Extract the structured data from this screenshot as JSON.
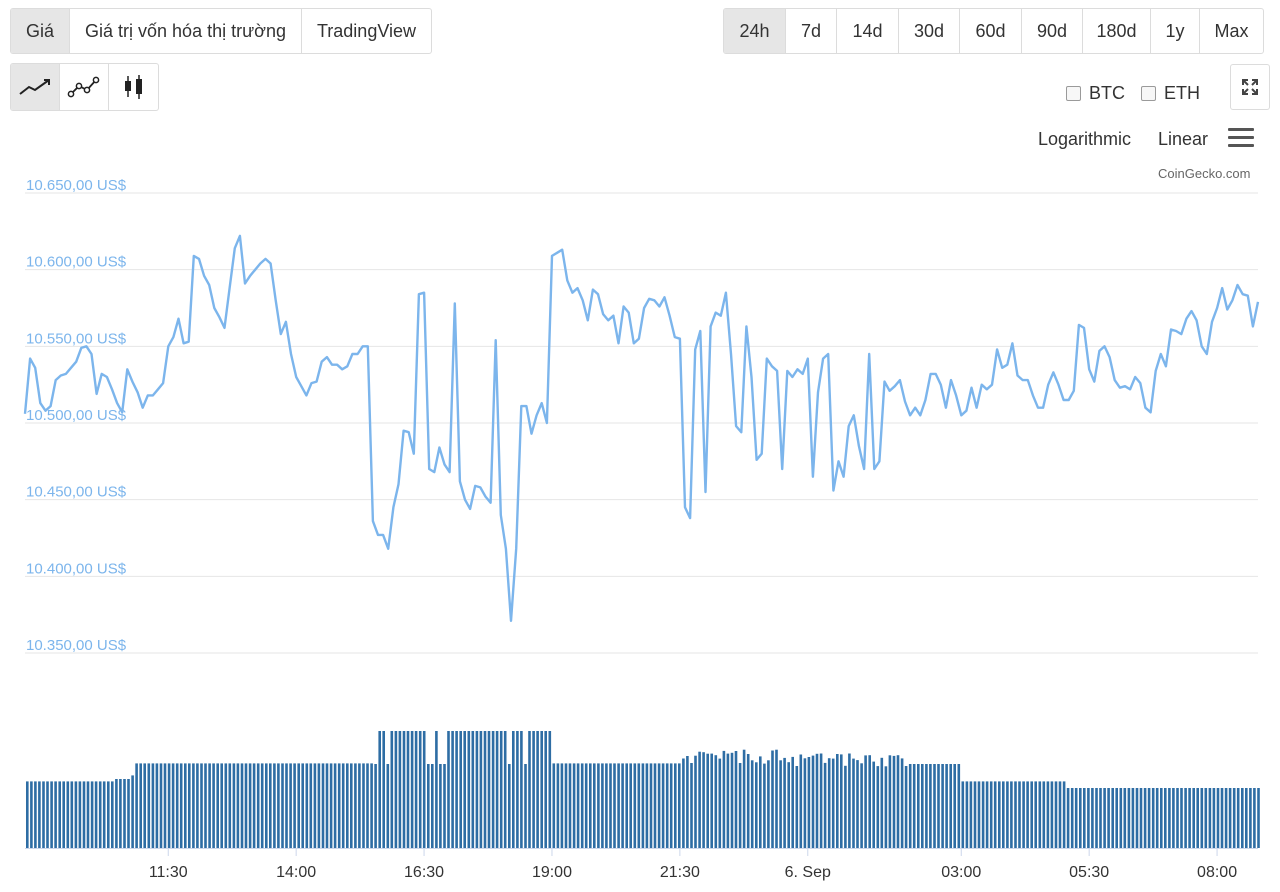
{
  "tabs": [
    {
      "label": "Giá",
      "active": true
    },
    {
      "label": "Giá trị vốn hóa thị trường",
      "active": false
    },
    {
      "label": "TradingView",
      "active": false
    }
  ],
  "ranges": [
    {
      "label": "24h",
      "active": true
    },
    {
      "label": "7d",
      "active": false
    },
    {
      "label": "14d",
      "active": false
    },
    {
      "label": "30d",
      "active": false
    },
    {
      "label": "60d",
      "active": false
    },
    {
      "label": "90d",
      "active": false
    },
    {
      "label": "180d",
      "active": false
    },
    {
      "label": "1y",
      "active": false
    },
    {
      "label": "Max",
      "active": false
    }
  ],
  "chart_styles": [
    {
      "icon": "line-chart-icon",
      "active": true
    },
    {
      "icon": "point-line-chart-icon",
      "active": false
    },
    {
      "icon": "candlestick-chart-icon",
      "active": false
    }
  ],
  "compare": {
    "btc": "BTC",
    "eth": "ETH"
  },
  "scale": {
    "logarithmic": "Logarithmic",
    "linear": "Linear"
  },
  "credit": "CoinGecko.com",
  "colors": {
    "line": "#7cb5ec",
    "volume": "#2e6da4",
    "axis_text": "#7cb5ec",
    "grid": "#e6e6e6"
  },
  "chart_data": {
    "type": "line",
    "y_axis": {
      "ticks": [
        10650,
        10600,
        10550,
        10500,
        10450,
        10400,
        10350
      ],
      "tick_labels": [
        "10.650,00 US$",
        "10.600,00 US$",
        "10.550,00 US$",
        "10.500,00 US$",
        "10.450,00 US$",
        "10.400,00 US$",
        "10.350,00 US$"
      ],
      "range": [
        10350,
        10650
      ]
    },
    "x_axis": {
      "ticks": [
        "11:30",
        "14:00",
        "16:30",
        "19:00",
        "21:30",
        "6. Sep",
        "03:00",
        "05:30",
        "08:00"
      ],
      "range_hours": [
        8.7,
        32.8
      ],
      "tick_hours": [
        11.5,
        14,
        16.5,
        19,
        21.5,
        24,
        27,
        29.5,
        32
      ]
    },
    "price_series": [
      [
        8.7,
        10506
      ],
      [
        8.8,
        10542
      ],
      [
        8.9,
        10536
      ],
      [
        9.0,
        10513
      ],
      [
        9.1,
        10508
      ],
      [
        9.2,
        10511
      ],
      [
        9.3,
        10528
      ],
      [
        9.4,
        10531
      ],
      [
        9.5,
        10532
      ],
      [
        9.6,
        10536
      ],
      [
        9.7,
        10540
      ],
      [
        9.8,
        10549
      ],
      [
        9.9,
        10550
      ],
      [
        10.0,
        10545
      ],
      [
        10.1,
        10519
      ],
      [
        10.2,
        10532
      ],
      [
        10.3,
        10530
      ],
      [
        10.4,
        10522
      ],
      [
        10.5,
        10513
      ],
      [
        10.6,
        10507
      ],
      [
        10.7,
        10535
      ],
      [
        10.8,
        10527
      ],
      [
        10.9,
        10520
      ],
      [
        11.0,
        10510
      ],
      [
        11.1,
        10518
      ],
      [
        11.2,
        10518
      ],
      [
        11.3,
        10522
      ],
      [
        11.4,
        10526
      ],
      [
        11.5,
        10550
      ],
      [
        11.6,
        10556
      ],
      [
        11.7,
        10568
      ],
      [
        11.8,
        10552
      ],
      [
        11.9,
        10553
      ],
      [
        12.0,
        10609
      ],
      [
        12.1,
        10607
      ],
      [
        12.2,
        10596
      ],
      [
        12.3,
        10590
      ],
      [
        12.4,
        10575
      ],
      [
        12.5,
        10569
      ],
      [
        12.6,
        10562
      ],
      [
        12.7,
        10588
      ],
      [
        12.8,
        10614
      ],
      [
        12.9,
        10622
      ],
      [
        13.0,
        10591
      ],
      [
        13.1,
        10596
      ],
      [
        13.2,
        10600
      ],
      [
        13.3,
        10604
      ],
      [
        13.4,
        10607
      ],
      [
        13.5,
        10604
      ],
      [
        13.6,
        10580
      ],
      [
        13.7,
        10558
      ],
      [
        13.8,
        10566
      ],
      [
        13.9,
        10545
      ],
      [
        14.0,
        10530
      ],
      [
        14.1,
        10524
      ],
      [
        14.2,
        10518
      ],
      [
        14.3,
        10526
      ],
      [
        14.4,
        10527
      ],
      [
        14.5,
        10540
      ],
      [
        14.6,
        10543
      ],
      [
        14.7,
        10538
      ],
      [
        14.8,
        10538
      ],
      [
        14.9,
        10535
      ],
      [
        15.0,
        10537
      ],
      [
        15.1,
        10545
      ],
      [
        15.2,
        10545
      ],
      [
        15.3,
        10550
      ],
      [
        15.4,
        10550
      ],
      [
        15.5,
        10436
      ],
      [
        15.6,
        10427
      ],
      [
        15.7,
        10427
      ],
      [
        15.8,
        10418
      ],
      [
        15.9,
        10445
      ],
      [
        16.0,
        10460
      ],
      [
        16.1,
        10495
      ],
      [
        16.2,
        10494
      ],
      [
        16.3,
        10480
      ],
      [
        16.4,
        10584
      ],
      [
        16.5,
        10585
      ],
      [
        16.6,
        10470
      ],
      [
        16.7,
        10468
      ],
      [
        16.8,
        10484
      ],
      [
        16.9,
        10473
      ],
      [
        17.0,
        10468
      ],
      [
        17.1,
        10578
      ],
      [
        17.2,
        10462
      ],
      [
        17.3,
        10450
      ],
      [
        17.4,
        10444
      ],
      [
        17.5,
        10459
      ],
      [
        17.6,
        10458
      ],
      [
        17.7,
        10452
      ],
      [
        17.8,
        10448
      ],
      [
        17.9,
        10554
      ],
      [
        18.0,
        10440
      ],
      [
        18.1,
        10418
      ],
      [
        18.2,
        10371
      ],
      [
        18.3,
        10418
      ],
      [
        18.4,
        10511
      ],
      [
        18.5,
        10511
      ],
      [
        18.6,
        10493
      ],
      [
        18.7,
        10505
      ],
      [
        18.8,
        10513
      ],
      [
        18.9,
        10500
      ],
      [
        19.0,
        10609
      ],
      [
        19.1,
        10611
      ],
      [
        19.2,
        10613
      ],
      [
        19.3,
        10593
      ],
      [
        19.4,
        10585
      ],
      [
        19.5,
        10588
      ],
      [
        19.6,
        10580
      ],
      [
        19.7,
        10567
      ],
      [
        19.8,
        10587
      ],
      [
        19.9,
        10584
      ],
      [
        20.0,
        10571
      ],
      [
        20.1,
        10567
      ],
      [
        20.2,
        10570
      ],
      [
        20.3,
        10552
      ],
      [
        20.4,
        10576
      ],
      [
        20.5,
        10572
      ],
      [
        20.6,
        10552
      ],
      [
        20.7,
        10555
      ],
      [
        20.8,
        10575
      ],
      [
        20.9,
        10581
      ],
      [
        21.0,
        10580
      ],
      [
        21.1,
        10576
      ],
      [
        21.2,
        10582
      ],
      [
        21.3,
        10570
      ],
      [
        21.4,
        10556
      ],
      [
        21.5,
        10555
      ],
      [
        21.6,
        10445
      ],
      [
        21.7,
        10438
      ],
      [
        21.8,
        10548
      ],
      [
        21.9,
        10560
      ],
      [
        22.0,
        10455
      ],
      [
        22.1,
        10563
      ],
      [
        22.2,
        10572
      ],
      [
        22.3,
        10570
      ],
      [
        22.4,
        10585
      ],
      [
        22.5,
        10545
      ],
      [
        22.6,
        10498
      ],
      [
        22.7,
        10494
      ],
      [
        22.8,
        10563
      ],
      [
        22.9,
        10530
      ],
      [
        23.0,
        10476
      ],
      [
        23.1,
        10480
      ],
      [
        23.2,
        10542
      ],
      [
        23.3,
        10537
      ],
      [
        23.4,
        10534
      ],
      [
        23.5,
        10470
      ],
      [
        23.6,
        10534
      ],
      [
        23.7,
        10530
      ],
      [
        23.8,
        10535
      ],
      [
        23.9,
        10532
      ],
      [
        24.0,
        10542
      ],
      [
        24.1,
        10465
      ],
      [
        24.2,
        10520
      ],
      [
        24.3,
        10542
      ],
      [
        24.4,
        10545
      ],
      [
        24.5,
        10456
      ],
      [
        24.6,
        10475
      ],
      [
        24.7,
        10465
      ],
      [
        24.8,
        10498
      ],
      [
        24.9,
        10505
      ],
      [
        25.0,
        10485
      ],
      [
        25.1,
        10470
      ],
      [
        25.2,
        10545
      ],
      [
        25.3,
        10470
      ],
      [
        25.4,
        10475
      ],
      [
        25.5,
        10527
      ],
      [
        25.6,
        10521
      ],
      [
        25.7,
        10524
      ],
      [
        25.8,
        10528
      ],
      [
        25.9,
        10514
      ],
      [
        26.0,
        10505
      ],
      [
        26.1,
        10510
      ],
      [
        26.2,
        10505
      ],
      [
        26.3,
        10515
      ],
      [
        26.4,
        10532
      ],
      [
        26.5,
        10532
      ],
      [
        26.6,
        10525
      ],
      [
        26.7,
        10510
      ],
      [
        26.8,
        10528
      ],
      [
        26.9,
        10518
      ],
      [
        27.0,
        10505
      ],
      [
        27.1,
        10508
      ],
      [
        27.2,
        10523
      ],
      [
        27.3,
        10510
      ],
      [
        27.4,
        10525
      ],
      [
        27.5,
        10522
      ],
      [
        27.6,
        10525
      ],
      [
        27.7,
        10548
      ],
      [
        27.8,
        10536
      ],
      [
        27.9,
        10538
      ],
      [
        28.0,
        10552
      ],
      [
        28.1,
        10531
      ],
      [
        28.2,
        10528
      ],
      [
        28.3,
        10528
      ],
      [
        28.4,
        10518
      ],
      [
        28.5,
        10510
      ],
      [
        28.6,
        10510
      ],
      [
        28.7,
        10525
      ],
      [
        28.8,
        10533
      ],
      [
        28.9,
        10525
      ],
      [
        29.0,
        10515
      ],
      [
        29.1,
        10515
      ],
      [
        29.2,
        10521
      ],
      [
        29.3,
        10564
      ],
      [
        29.4,
        10562
      ],
      [
        29.5,
        10535
      ],
      [
        29.6,
        10527
      ],
      [
        29.7,
        10547
      ],
      [
        29.8,
        10550
      ],
      [
        29.9,
        10543
      ],
      [
        30.0,
        10528
      ],
      [
        30.1,
        10523
      ],
      [
        30.2,
        10524
      ],
      [
        30.3,
        10522
      ],
      [
        30.4,
        10530
      ],
      [
        30.5,
        10526
      ],
      [
        30.6,
        10510
      ],
      [
        30.7,
        10507
      ],
      [
        30.8,
        10534
      ],
      [
        30.9,
        10545
      ],
      [
        31.0,
        10537
      ],
      [
        31.1,
        10561
      ],
      [
        31.2,
        10560
      ],
      [
        31.3,
        10558
      ],
      [
        31.4,
        10568
      ],
      [
        31.5,
        10573
      ],
      [
        31.6,
        10567
      ],
      [
        31.7,
        10550
      ],
      [
        31.8,
        10545
      ],
      [
        31.9,
        10566
      ],
      [
        32.0,
        10575
      ],
      [
        32.1,
        10588
      ],
      [
        32.2,
        10574
      ],
      [
        32.3,
        10580
      ],
      [
        32.4,
        10590
      ],
      [
        32.5,
        10584
      ],
      [
        32.6,
        10583
      ],
      [
        32.7,
        10563
      ],
      [
        32.8,
        10579
      ]
    ],
    "volume_series": {
      "note_levels": "relative volume, 1.0 = tallest bar",
      "segments": [
        {
          "from": 8.7,
          "to": 10.4,
          "level": 0.555
        },
        {
          "from": 10.4,
          "to": 10.7,
          "level": 0.575
        },
        {
          "from": 10.7,
          "to": 10.85,
          "level": 0.605
        },
        {
          "from": 10.85,
          "to": 15.5,
          "level": 0.705
        },
        {
          "from": 15.5,
          "to": 19.0,
          "level": 0.975
        },
        {
          "from": 19.0,
          "to": 21.5,
          "level": 0.705
        },
        {
          "from": 21.5,
          "to": 23.7,
          "level": 0.75
        },
        {
          "from": 23.7,
          "to": 25.9,
          "level": 0.73
        },
        {
          "from": 25.9,
          "to": 27.0,
          "level": 0.7
        },
        {
          "from": 27.0,
          "to": 29.0,
          "level": 0.555
        },
        {
          "from": 29.0,
          "to": 32.8,
          "level": 0.5
        }
      ]
    }
  }
}
